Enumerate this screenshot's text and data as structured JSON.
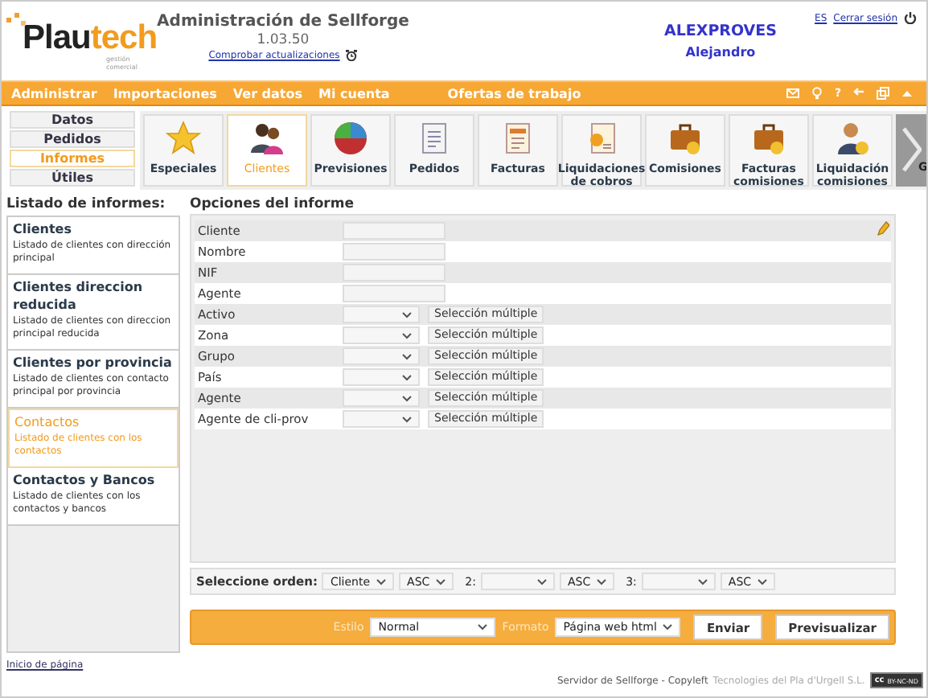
{
  "header": {
    "logo": {
      "main": "Plau",
      "accent": "tech",
      "tagline": "gestión comercial"
    },
    "title": "Administración de Sellforge",
    "version": "1.03.50",
    "update_link": "Comprobar actualizaciones",
    "user": {
      "login": "ALEXPROVES",
      "name": "Alejandro"
    },
    "language": "ES",
    "logout": "Cerrar sesión"
  },
  "menu": {
    "items": [
      "Administrar",
      "Importaciones",
      "Ver datos",
      "Mi cuenta",
      "Ofertas de trabajo"
    ],
    "tools": [
      {
        "kind": "mail"
      },
      {
        "kind": "bulb"
      },
      {
        "kind": "help",
        "label": "?"
      },
      {
        "kind": "back"
      },
      {
        "kind": "windows"
      },
      {
        "kind": "collapse"
      }
    ]
  },
  "sections": [
    {
      "label": "Datos",
      "selected": false
    },
    {
      "label": "Pedidos",
      "selected": false
    },
    {
      "label": "Informes",
      "selected": true
    },
    {
      "label": "Útiles",
      "selected": false
    }
  ],
  "tiles": [
    {
      "label": "Especiales",
      "kind": "star",
      "selected": false
    },
    {
      "label": "Clientes",
      "kind": "people",
      "selected": true
    },
    {
      "label": "Previsiones",
      "kind": "pie",
      "selected": false
    },
    {
      "label": "Pedidos",
      "kind": "document",
      "selected": false
    },
    {
      "label": "Facturas",
      "kind": "invoice",
      "selected": false
    },
    {
      "label": "Liquidaciones de cobros",
      "kind": "payment",
      "selected": false
    },
    {
      "label": "Comisiones",
      "kind": "briefcase",
      "selected": false
    },
    {
      "label": "Facturas comisiones",
      "kind": "briefcase",
      "selected": false
    },
    {
      "label": "Liquidación comisiones",
      "kind": "person",
      "selected": false
    }
  ],
  "tiles_more": {
    "label": "G"
  },
  "reports": {
    "heading": "Listado de informes:",
    "items": [
      {
        "title": "Clientes",
        "description": "Listado de clientes con dirección principal",
        "selected": false
      },
      {
        "title": "Clientes direccion reducida",
        "description": "Listado de clientes con direccion principal reducida",
        "selected": false
      },
      {
        "title": "Clientes por provincia",
        "description": "Listado de clientes con contacto principal por provincia",
        "selected": false
      },
      {
        "title": "Contactos",
        "description": "Listado de clientes con los contactos",
        "selected": true
      },
      {
        "title": "Contactos y Bancos",
        "description": "Listado de clientes con los contactos y bancos",
        "selected": false
      }
    ]
  },
  "options": {
    "heading": "Opciones del informe",
    "fields": [
      {
        "label": "Cliente",
        "kind": "text"
      },
      {
        "label": "Nombre",
        "kind": "text"
      },
      {
        "label": "NIF",
        "kind": "text"
      },
      {
        "label": "Agente",
        "kind": "text"
      },
      {
        "label": "Activo",
        "kind": "select",
        "button": "Selección múltiple"
      },
      {
        "label": "Zona",
        "kind": "select",
        "button": "Selección múltiple"
      },
      {
        "label": "Grupo",
        "kind": "select",
        "button": "Selección múltiple"
      },
      {
        "label": "País",
        "kind": "select",
        "button": "Selección múltiple"
      },
      {
        "label": "Agente",
        "kind": "select",
        "button": "Selección múltiple"
      },
      {
        "label": "Agente de cli-prov",
        "kind": "select",
        "button": "Selección múltiple"
      }
    ]
  },
  "order": {
    "label": "Seleccione orden:",
    "levels": [
      {
        "field": "Cliente",
        "direction": "ASC"
      },
      {
        "prefix": "2:",
        "direction": "ASC"
      },
      {
        "prefix": "3:",
        "direction": "ASC"
      }
    ]
  },
  "output": {
    "style_label": "Estilo",
    "style": "Normal",
    "format_label": "Formato",
    "format": "Página web html",
    "buttons": [
      "Enviar",
      "Previsualizar"
    ]
  },
  "footer": {
    "top_link": "Inicio de página",
    "server": "Servidor de Sellforge - Copyleft",
    "company": "Tecnologies del Pla d'Urgell S.L.",
    "license": {
      "mark": "cc",
      "terms": "BY-NC-ND"
    }
  }
}
